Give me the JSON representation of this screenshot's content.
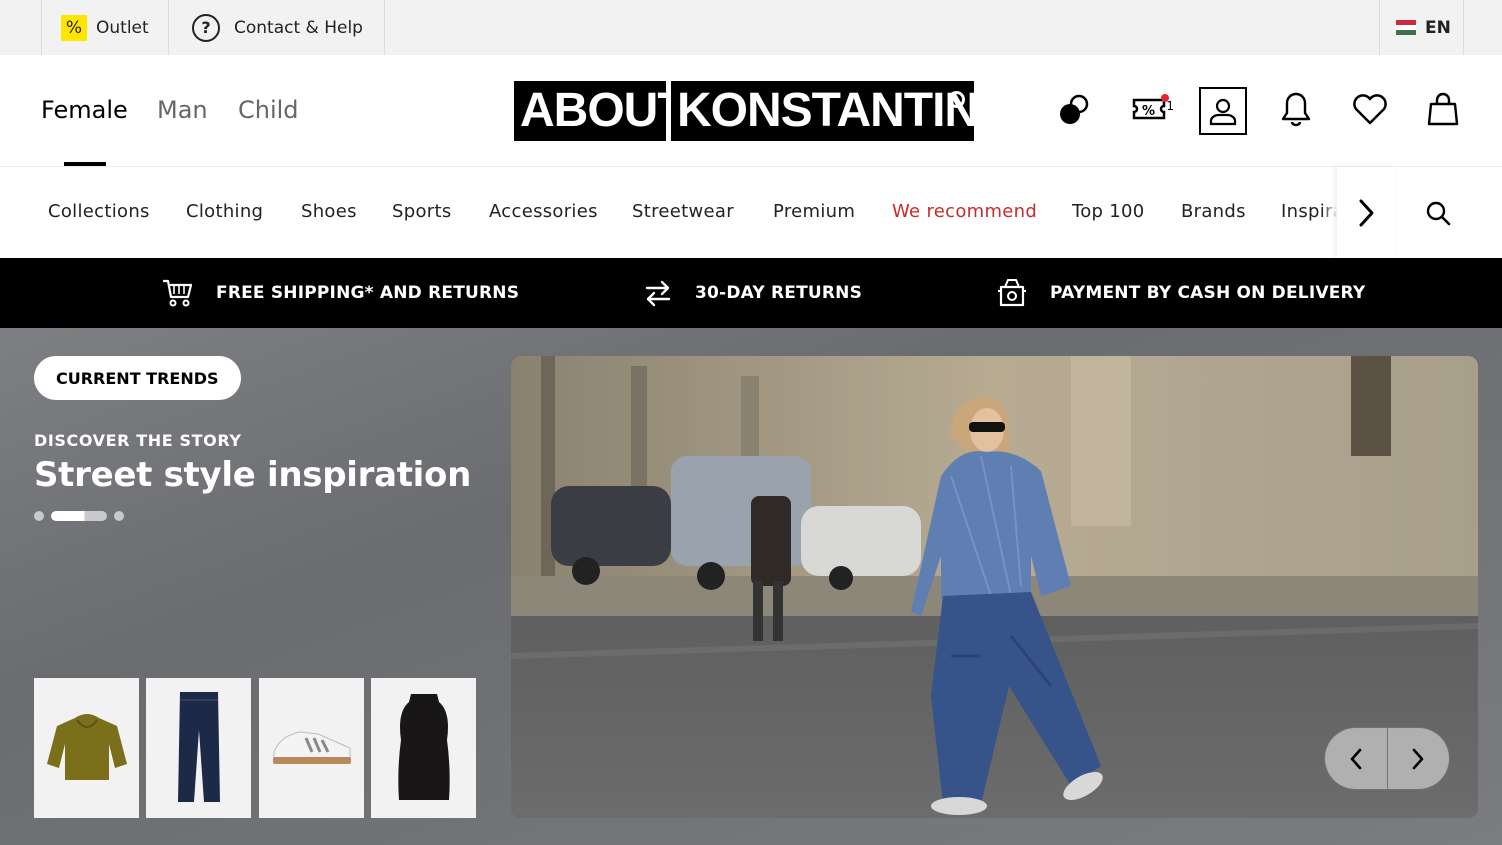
{
  "utility": {
    "outlet_label": "Outlet",
    "outlet_badge": "%",
    "help_label": "Contact & Help",
    "language": "EN"
  },
  "header": {
    "gender_tabs": [
      "Female",
      "Man",
      "Child"
    ],
    "active_tab": "Female",
    "logo": {
      "part1": "ABOUT",
      "part2": "KONSTANTIN"
    },
    "coupon_count": "1"
  },
  "categories": [
    "Collections",
    "Clothing",
    "Shoes",
    "Sports",
    "Accessories",
    "Streetwear",
    "Premium",
    "We recommend",
    "Top 100",
    "Brands",
    "Inspira"
  ],
  "benefits": [
    {
      "label": "FREE SHIPPING* AND RETURNS",
      "icon": "cart-icon"
    },
    {
      "label": "30-DAY RETURNS",
      "icon": "return-arrows-icon"
    },
    {
      "label": "PAYMENT BY CASH ON DELIVERY",
      "icon": "cash-payment-icon"
    }
  ],
  "hero": {
    "chip": "CURRENT TRENDS",
    "eyebrow": "DISCOVER THE STORY",
    "title": "Street style inspiration",
    "slide_count": 3,
    "active_slide": 2,
    "products": [
      "hoodie",
      "jeans",
      "sneaker",
      "top"
    ]
  },
  "colors": {
    "accent_recommend": "#cc2b2b",
    "outlet_yellow": "#ffe600",
    "benefit_bar": "#000000"
  }
}
